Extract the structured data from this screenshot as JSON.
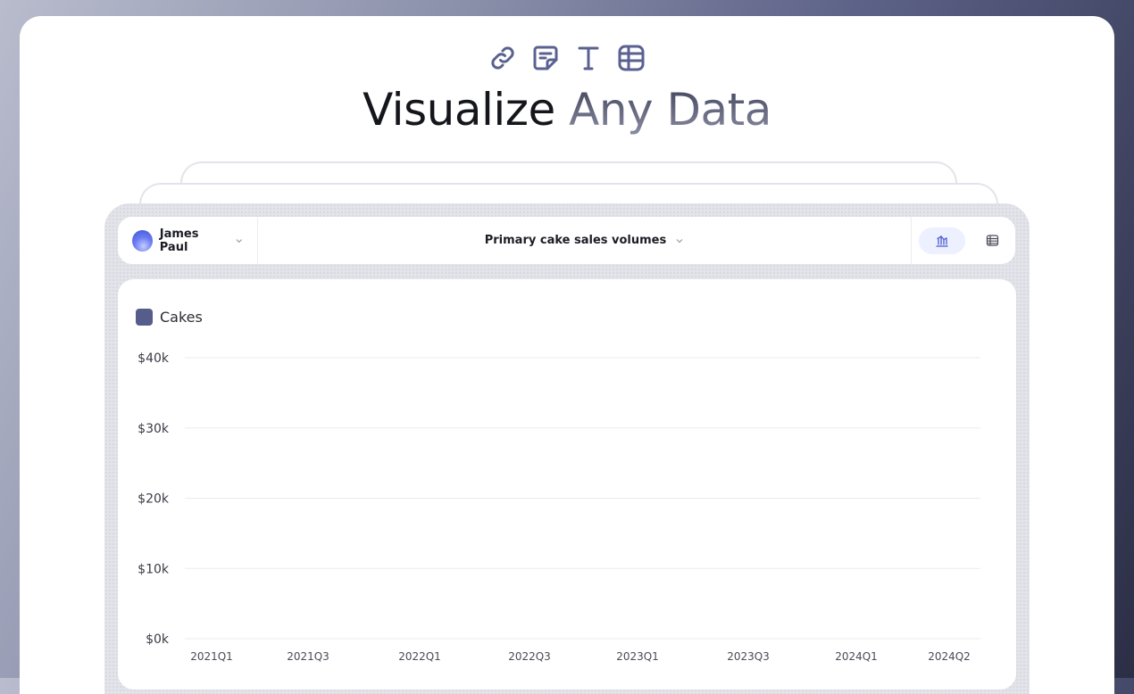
{
  "hero": {
    "title_main": "Visualize",
    "title_accent": "Any Data",
    "icons": [
      "link-icon",
      "sticky-note-icon",
      "text-icon",
      "table-icon"
    ]
  },
  "toolbar": {
    "user_name": "James Paul",
    "dataset": "Primary cake sales volumes",
    "views": [
      "bar-chart-view-icon",
      "table-view-icon"
    ]
  },
  "colors": {
    "accent": "#565d8b",
    "icon": "#5a6190",
    "active_view_bg": "#edf0ff"
  },
  "chart_data": {
    "type": "bar",
    "series": [
      {
        "name": "Cakes",
        "values": []
      }
    ],
    "categories": [
      "2021Q1",
      "2021Q3",
      "2022Q1",
      "2022Q3",
      "2023Q1",
      "2023Q3",
      "2024Q1",
      "2024Q2"
    ],
    "y_ticks": [
      "$40k",
      "$30k",
      "$20k",
      "$10k",
      "$0k"
    ],
    "ylim": [
      0,
      40000
    ],
    "grid": true,
    "legend": "top-left"
  }
}
